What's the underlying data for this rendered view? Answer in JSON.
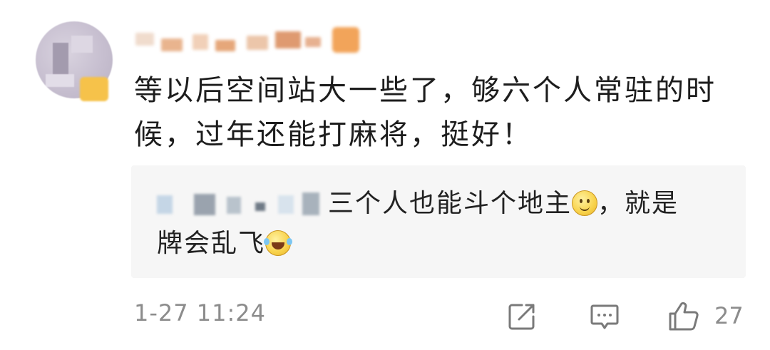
{
  "comment": {
    "text_line1": "等以后空间站大一些了，够六个人常驻的时",
    "text_line2": "候，过年还能打麻将，挺好！",
    "timestamp": "1-27 11:24",
    "like_count": "27"
  },
  "reply": {
    "text_part1": "三个人也能斗个地主",
    "text_part2": "，就是",
    "text_part3": "牌会乱飞",
    "emoji1": "smile-emoji",
    "emoji2": "laugh-cry-emoji"
  },
  "icons": {
    "share": "share-icon",
    "reply": "comment-icon",
    "like": "thumbs-up-icon"
  },
  "colors": {
    "reply_background": "#f6f6f6",
    "meta_text": "#8c8c8c",
    "vip_badge": "#f6c24a"
  }
}
